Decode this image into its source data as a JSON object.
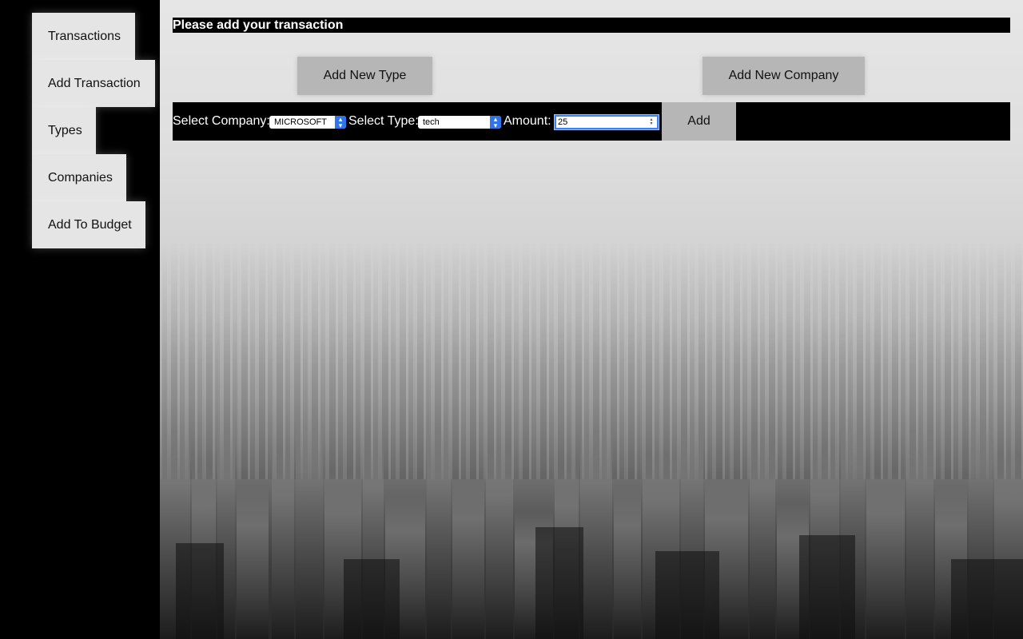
{
  "sidebar": {
    "items": [
      {
        "label": "Transactions"
      },
      {
        "label": "Add Transaction"
      },
      {
        "label": "Types"
      },
      {
        "label": "Companies"
      },
      {
        "label": "Add To Budget"
      }
    ]
  },
  "main": {
    "heading": "Please add your transaction",
    "add_type_label": "Add New Type",
    "add_company_label": "Add New Company"
  },
  "form": {
    "company_label": "Select Company:",
    "company_value": "MICROSOFT",
    "type_label": "Select Type:",
    "type_value": "tech",
    "amount_label": "Amount:",
    "amount_value": "25",
    "add_label": "Add"
  },
  "colors": {
    "sidebar_bg": "#000000",
    "nav_item_bg": "#e5e5e5",
    "button_bg": "#b6b6b6",
    "select_accent": "#2f74e8",
    "focus_ring": "#3b82f6"
  }
}
